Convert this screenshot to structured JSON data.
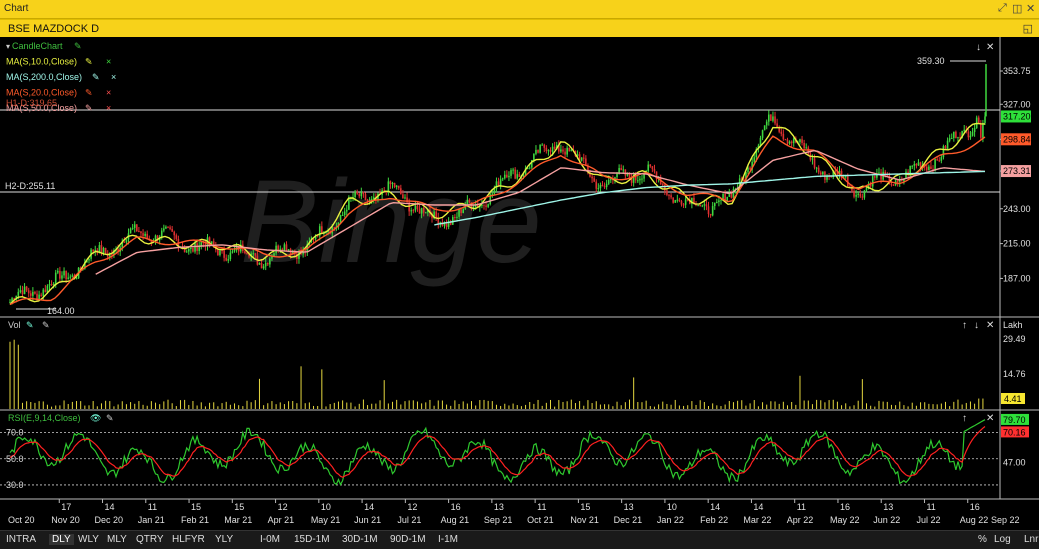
{
  "window": {
    "title": "Chart"
  },
  "symbol_bar": {
    "title": "BSE MAZDOCK D"
  },
  "panes": {
    "price": {
      "indicators": [
        {
          "label": "CandleChart",
          "color": "#3fbf3f"
        },
        {
          "label": "MA(S,10.0,Close)",
          "color": "#e8f040"
        },
        {
          "label": "MA(S,200.0,Close)",
          "color": "#9ff5e8"
        },
        {
          "label": "MA(S,20.0,Close)",
          "color": "#ff5a2a"
        },
        {
          "label": "MA(S,50.0,Close)",
          "color": "#f5a0a0"
        }
      ],
      "overlay_label": "H1-D:319.65",
      "hline_label": "H2-D:255.11",
      "low_label": "164.00",
      "high_label": "359.30",
      "y_ticks": [
        "353.75",
        "327.00",
        "298.84",
        "273.31",
        "243.00",
        "215.00",
        "187.00"
      ],
      "price_badges": [
        {
          "text": "317.20",
          "color": "#2ee03a"
        },
        {
          "text": "298.84",
          "color": "#ff5a2a"
        },
        {
          "text": "273.31",
          "color": "#f5a0a0"
        }
      ],
      "watermark": "Binge"
    },
    "volume": {
      "label": "Vol",
      "unit": "Lakh",
      "y_ticks": [
        "29.49",
        "14.76"
      ],
      "badge": "4.41"
    },
    "rsi": {
      "label": "RSI(E,9,14,Close)",
      "y_ticks": [
        "70.0",
        "50.0",
        "30.0"
      ],
      "right_ticks": [
        "47.00"
      ],
      "badges": [
        {
          "text": "79.70",
          "color": "#2ee03a"
        },
        {
          "text": "70.16",
          "color": "#ff3030"
        }
      ]
    }
  },
  "x_axis": {
    "labels": [
      {
        "day": "",
        "month": "Oct 20"
      },
      {
        "day": "17",
        "month": "Nov 20"
      },
      {
        "day": "14",
        "month": "Dec 20"
      },
      {
        "day": "11",
        "month": "Jan 21"
      },
      {
        "day": "15",
        "month": "Feb 21"
      },
      {
        "day": "15",
        "month": "Mar 21"
      },
      {
        "day": "12",
        "month": "Apr 21"
      },
      {
        "day": "10",
        "month": "May 21"
      },
      {
        "day": "14",
        "month": "Jun 21"
      },
      {
        "day": "12",
        "month": "Jul 21"
      },
      {
        "day": "16",
        "month": "Aug 21"
      },
      {
        "day": "13",
        "month": "Sep 21"
      },
      {
        "day": "11",
        "month": "Oct 21"
      },
      {
        "day": "15",
        "month": "Nov 21"
      },
      {
        "day": "13",
        "month": "Dec 21"
      },
      {
        "day": "10",
        "month": "Jan 22"
      },
      {
        "day": "14",
        "month": "Feb 22"
      },
      {
        "day": "14",
        "month": "Mar 22"
      },
      {
        "day": "11",
        "month": "Apr 22"
      },
      {
        "day": "16",
        "month": "May 22"
      },
      {
        "day": "13",
        "month": "Jun 22"
      },
      {
        "day": "11",
        "month": "Jul 22"
      },
      {
        "day": "16",
        "month": "Aug 22"
      },
      {
        "day": "",
        "month": "Sep 22"
      }
    ]
  },
  "bottom_bar": {
    "periods": [
      "INTRA",
      "DLY",
      "WLY",
      "MLY",
      "QTRY",
      "HLFYR",
      "YLY"
    ],
    "selected": "DLY",
    "ranges": [
      "I-0M",
      "15D-1M",
      "30D-1M",
      "90D-1M",
      "I-1M"
    ],
    "right": [
      "%",
      "Log",
      "Lnr"
    ]
  },
  "chart_data": {
    "type": "candlestick",
    "title": "BSE MAZDOCK D",
    "x_range": [
      "Oct 20",
      "Sep 22"
    ],
    "ylim": [
      160,
      365
    ],
    "key_levels": {
      "high": 359.3,
      "low": 164.0,
      "last_close": 317.2,
      "H1": 319.65,
      "H2": 255.11
    },
    "series": [
      {
        "name": "Close",
        "x": [
          "Oct 20",
          "Nov 20",
          "Dec 20",
          "Jan 21",
          "Feb 21",
          "Mar 21",
          "Apr 21",
          "May 21",
          "Jun 21",
          "Jul 21",
          "Aug 21",
          "Sep 21",
          "Oct 21",
          "Nov 21",
          "Dec 21",
          "Jan 22",
          "Feb 22",
          "Mar 22",
          "Apr 22",
          "May 22",
          "Jun 22",
          "Jul 22",
          "Aug 22",
          "Sep 22"
        ],
        "values": [
          168,
          178,
          210,
          222,
          214,
          215,
          200,
          212,
          250,
          254,
          235,
          248,
          270,
          300,
          262,
          270,
          250,
          248,
          315,
          283,
          255,
          268,
          292,
          317
        ]
      },
      {
        "name": "MA(S,10.0,Close)",
        "values": [
          166,
          176,
          205,
          220,
          215,
          214,
          204,
          210,
          248,
          254,
          238,
          247,
          268,
          296,
          265,
          270,
          251,
          249,
          312,
          285,
          256,
          267,
          290,
          314
        ]
      },
      {
        "name": "MA(S,20.0,Close)",
        "values": [
          166,
          172,
          200,
          218,
          216,
          214,
          206,
          208,
          240,
          254,
          242,
          246,
          265,
          288,
          268,
          270,
          255,
          250,
          300,
          288,
          260,
          265,
          285,
          299
        ]
      },
      {
        "name": "MA(S,50.0,Close)",
        "values": [
          null,
          null,
          190,
          208,
          212,
          214,
          210,
          208,
          228,
          248,
          246,
          246,
          256,
          276,
          272,
          271,
          262,
          255,
          282,
          290,
          275,
          266,
          276,
          273
        ]
      },
      {
        "name": "MA(S,200.0,Close)",
        "values": [
          null,
          null,
          null,
          null,
          null,
          null,
          null,
          null,
          null,
          null,
          230,
          236,
          243,
          250,
          256,
          260,
          262,
          263,
          266,
          269,
          270,
          271,
          272,
          273
        ]
      }
    ],
    "volume": {
      "name": "Vol",
      "unit": "Lakh",
      "ylim": [
        0,
        35
      ],
      "last": 4.41
    },
    "rsi": {
      "name": "RSI(E,9,14,Close)",
      "ylim": [
        20,
        85
      ],
      "levels": [
        70,
        50,
        30
      ],
      "last": 79.7,
      "signal_last": 70.16
    }
  }
}
